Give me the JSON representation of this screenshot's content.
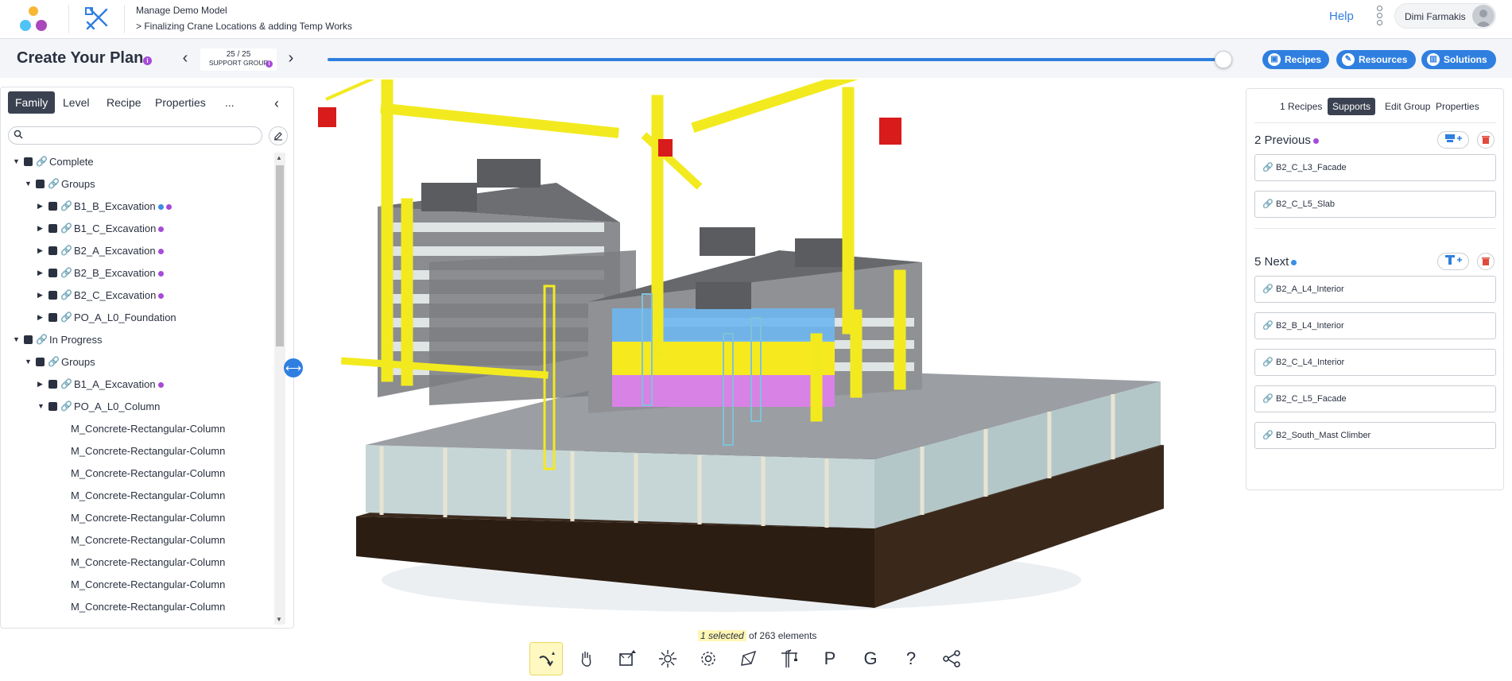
{
  "header": {
    "model_title": "Manage Demo Model",
    "breadcrumb": "> Finalizing Crane Locations & adding Temp Works",
    "help_label": "Help",
    "user_name": "Dimi Farmakis"
  },
  "plan": {
    "title": "Create Your Plan",
    "info_glyph": "i",
    "counter": "25 / 25",
    "counter_label": "SUPPORT GROUP",
    "slider_progress": 1.0,
    "buttons": {
      "recipes": "Recipes",
      "resources": "Resources",
      "solutions": "Solutions"
    }
  },
  "left": {
    "tabs": [
      "Family",
      "Level",
      "Recipe",
      "Properties",
      "..."
    ],
    "active_tab": "Family",
    "search_placeholder": "",
    "tree": [
      {
        "label": "Complete",
        "depth": 0,
        "caret": "down",
        "checkbox": true,
        "link": true,
        "dots": []
      },
      {
        "label": "Groups",
        "depth": 1,
        "caret": "down",
        "checkbox": true,
        "link": true,
        "dots": []
      },
      {
        "label": "B1_B_Excavation",
        "depth": 2,
        "caret": "right",
        "checkbox": true,
        "link": true,
        "dots": [
          "#3b8de6",
          "#a64bd9"
        ]
      },
      {
        "label": "B1_C_Excavation",
        "depth": 2,
        "caret": "right",
        "checkbox": true,
        "link": true,
        "dots": [
          "#a64bd9"
        ]
      },
      {
        "label": "B2_A_Excavation",
        "depth": 2,
        "caret": "right",
        "checkbox": true,
        "link": true,
        "dots": [
          "#a64bd9"
        ]
      },
      {
        "label": "B2_B_Excavation",
        "depth": 2,
        "caret": "right",
        "checkbox": true,
        "link": true,
        "dots": [
          "#a64bd9"
        ]
      },
      {
        "label": "B2_C_Excavation",
        "depth": 2,
        "caret": "right",
        "checkbox": true,
        "link": true,
        "dots": [
          "#a64bd9"
        ]
      },
      {
        "label": "PO_A_L0_Foundation",
        "depth": 2,
        "caret": "right",
        "checkbox": true,
        "link": true,
        "dots": []
      },
      {
        "label": "In Progress",
        "depth": 0,
        "caret": "down",
        "checkbox": true,
        "link": true,
        "dots": []
      },
      {
        "label": "Groups",
        "depth": 1,
        "caret": "down",
        "checkbox": true,
        "link": true,
        "dots": []
      },
      {
        "label": "B1_A_Excavation",
        "depth": 2,
        "caret": "right",
        "checkbox": true,
        "link": true,
        "dots": [
          "#a64bd9"
        ]
      },
      {
        "label": "PO_A_L0_Column",
        "depth": 2,
        "caret": "down",
        "checkbox": true,
        "link": true,
        "dots": []
      },
      {
        "label": "M_Concrete-Rectangular-Column",
        "depth": 3,
        "caret": "",
        "checkbox": false,
        "link": false,
        "dots": []
      },
      {
        "label": "M_Concrete-Rectangular-Column",
        "depth": 3,
        "caret": "",
        "checkbox": false,
        "link": false,
        "dots": []
      },
      {
        "label": "M_Concrete-Rectangular-Column",
        "depth": 3,
        "caret": "",
        "checkbox": false,
        "link": false,
        "dots": []
      },
      {
        "label": "M_Concrete-Rectangular-Column",
        "depth": 3,
        "caret": "",
        "checkbox": false,
        "link": false,
        "dots": []
      },
      {
        "label": "M_Concrete-Rectangular-Column",
        "depth": 3,
        "caret": "",
        "checkbox": false,
        "link": false,
        "dots": []
      },
      {
        "label": "M_Concrete-Rectangular-Column",
        "depth": 3,
        "caret": "",
        "checkbox": false,
        "link": false,
        "dots": []
      },
      {
        "label": "M_Concrete-Rectangular-Column",
        "depth": 3,
        "caret": "",
        "checkbox": false,
        "link": false,
        "dots": []
      },
      {
        "label": "M_Concrete-Rectangular-Column",
        "depth": 3,
        "caret": "",
        "checkbox": false,
        "link": false,
        "dots": []
      },
      {
        "label": "M_Concrete-Rectangular-Column",
        "depth": 3,
        "caret": "",
        "checkbox": false,
        "link": false,
        "dots": []
      }
    ]
  },
  "right": {
    "tabs": [
      "1 Recipes",
      "Supports",
      "Edit Group",
      "Properties"
    ],
    "active_tab": "Supports",
    "previous_title": "2 Previous",
    "previous_dot": "#a64bd9",
    "previous": [
      "B2_C_L3_Facade",
      "B2_C_L5_Slab"
    ],
    "next_title": "5 Next",
    "next_dot": "#3b8de6",
    "next": [
      "B2_A_L4_Interior",
      "B2_B_L4_Interior",
      "B2_C_L4_Interior",
      "B2_C_L5_Facade",
      "B2_South_Mast Climber"
    ]
  },
  "status": {
    "selected": "1 selected",
    "of_text": "of 263 elements"
  },
  "toolbar": {
    "tools": [
      "select-tool",
      "pan-hand-tool",
      "section-box-tool",
      "explode-tool",
      "settings-tool",
      "markup-tool",
      "crane-tool",
      "P",
      "G",
      "?",
      "share-tool"
    ]
  },
  "colors": {
    "accent": "#2f7fe0",
    "dark": "#3a4150",
    "purple": "#a64bd9",
    "blue": "#3b8de6",
    "crane_yellow": "#f2ea1f"
  }
}
